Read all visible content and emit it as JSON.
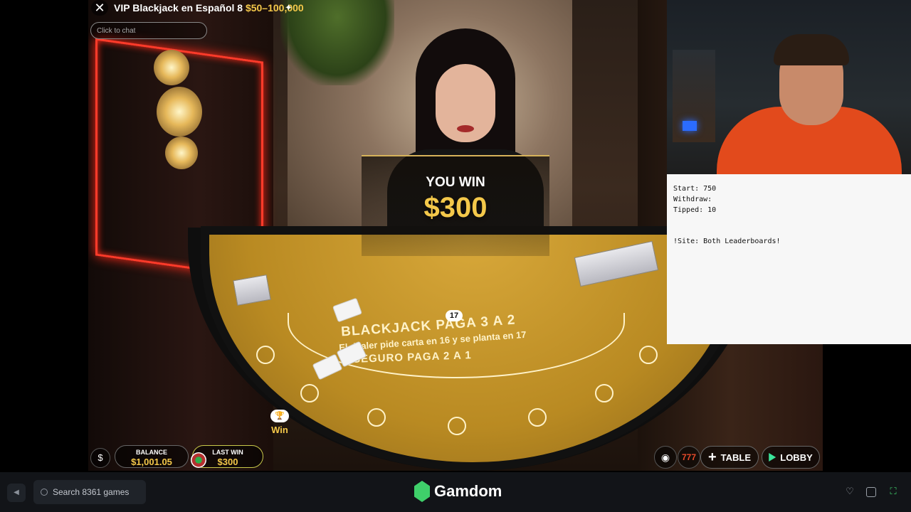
{
  "game": {
    "title": "VIP Blackjack en Español 8",
    "limits": "$50–100,000",
    "chat_placeholder": "Click to chat",
    "table_text": {
      "line1": "BLACKJACK PAGA 3 A 2",
      "line2": "El dealer pide carta en 16 y se planta en 17",
      "line3": "SEGURO PAGA 2 A 1"
    },
    "hand_score": "17",
    "win_banner": {
      "title": "YOU WIN",
      "amount": "$300"
    },
    "seat_result": "Win",
    "balance_label": "BALANCE",
    "balance_value": "$1,001.05",
    "last_win_label": "LAST WIN",
    "last_win_value": "$300",
    "slot_label": "777",
    "table_button": "TABLE",
    "lobby_button": "LOBBY"
  },
  "stats_overlay": {
    "start": "Start: 750",
    "withdraw": "Withdraw:",
    "tipped": "Tipped: 10",
    "command": "!Site: Both Leaderboards!"
  },
  "site_bar": {
    "search_placeholder": "Search 8361 games",
    "brand": "Gamdom"
  },
  "colors": {
    "accent_gold": "#f4c84a",
    "brand_green": "#3fd06a",
    "table_felt": "#c99a2a"
  }
}
